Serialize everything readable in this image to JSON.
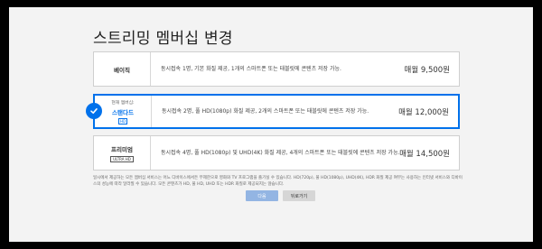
{
  "dialog": {
    "title": "스트리밍 멤버십 변경"
  },
  "plans": [
    {
      "name": "베이직",
      "description": "동시접속 1명, 기본 화질 제공, 1개의 스마트폰 또는 태블릿에 콘텐츠 저장 가능.",
      "price": "매월 9,500원"
    },
    {
      "current_badge": "현재 멤버십:",
      "name": "스탠다드",
      "quality_badge": "HD",
      "description": "동시접속 2명, 풀 HD(1080p) 화질 제공, 2개의 스마트폰 또는 태블릿에 콘텐츠 저장 가능.",
      "price": "매월 12,000원",
      "selected": true
    },
    {
      "name": "프리미엄",
      "quality_badge": "ULTRA HD",
      "description": "동시접속 4명, 풀 HD(1080p) 및 UHD(4K) 화질 제공, 4개의 스마트폰 또는 태블릿에 콘텐츠 저장 가능.",
      "price": "매월 14,500원"
    }
  ],
  "notice": "일시에서 제공하는 모든 멤버십 서비스는 어느 디바이스에서든 무제한으로 영화와 TV 프로그램을 즐기실 수 있습니다. HD(720p), 풀 HD(1080p), UHD(4K), HDR 화질 제공 여부는 사용하는 인터넷 서비스와 디바이스의 성능에 따라 달라질 수 있습니다. 모든 콘텐츠가 HD, 풀 HD, UHD 또는 HDR 화질로 제공되지는 않습니다.",
  "buttons": {
    "next": "다음",
    "back": "뒤로가기"
  },
  "colors": {
    "accent": "#0071eb",
    "next_button": "#93b5e3"
  },
  "icons": {
    "selected": "check-icon"
  }
}
